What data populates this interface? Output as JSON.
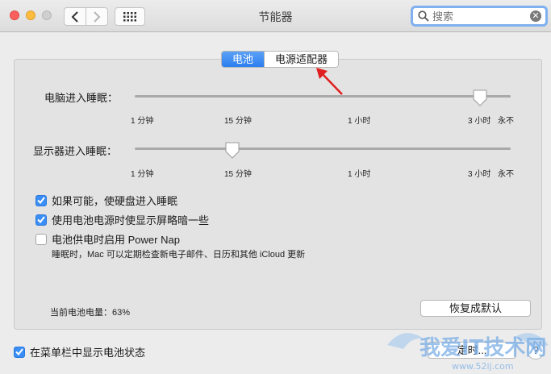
{
  "window": {
    "title": "节能器"
  },
  "search": {
    "placeholder": "搜索"
  },
  "tabs": [
    {
      "label": "电池"
    },
    {
      "label": "电源适配器"
    }
  ],
  "sliders": [
    {
      "label": "电脑进入睡眠：",
      "ticks": [
        "1 分钟",
        "15 分钟",
        "1 小时",
        "3 小时",
        "永不"
      ],
      "value_label": "3 小时"
    },
    {
      "label": "显示器进入睡眠：",
      "ticks": [
        "1 分钟",
        "15 分钟",
        "1 小时",
        "3 小时",
        "永不"
      ],
      "value_label": "15 分钟"
    }
  ],
  "options": [
    {
      "label": "如果可能，使硬盘进入睡眠",
      "checked": true
    },
    {
      "label": "使用电池电源时使显示屏略暗一些",
      "checked": true
    },
    {
      "label": "电池供电时启用 Power Nap",
      "checked": false
    }
  ],
  "power_nap_note": "睡眠时，Mac 可以定期检查新电子邮件、日历和其他 iCloud 更新",
  "battery": {
    "label": "当前电池电量：63%"
  },
  "buttons": {
    "restore_defaults": "恢复成默认",
    "schedule": "定时...",
    "help": "?"
  },
  "menu_bar_option": {
    "label": "在菜单栏中显示电池状态",
    "checked": true
  },
  "watermark": {
    "text": "我爱IT技术网",
    "url": "www.52ij.com"
  },
  "colors": {
    "accent": "#2c7ef0",
    "annotation_arrow": "#e02020"
  }
}
